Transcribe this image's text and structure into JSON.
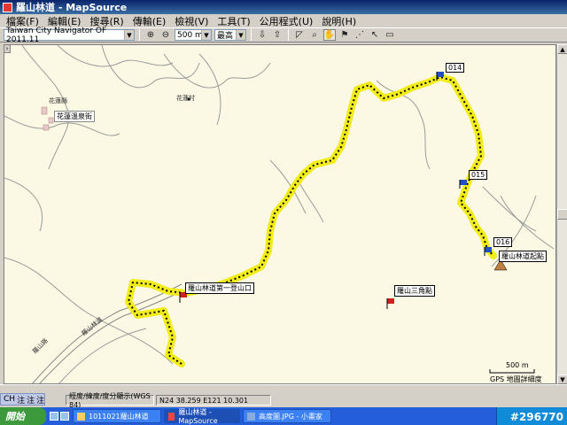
{
  "window": {
    "title": "羅山林道 - MapSource"
  },
  "menu": [
    "檔案(F)",
    "編輯(E)",
    "搜尋(R)",
    "傳輸(E)",
    "檢視(V)",
    "工具(T)",
    "公用程式(U)",
    "說明(H)"
  ],
  "toolbar": {
    "map_product": "Taiwan City Navigator OF 2011.11",
    "zoom": "500 m",
    "detail": "最高"
  },
  "map": {
    "waypoints": [
      {
        "id": "014",
        "label": "014"
      },
      {
        "id": "015",
        "label": "015"
      },
      {
        "id": "016",
        "label": "016"
      }
    ],
    "flags": [
      {
        "label": "羅山林道起點"
      },
      {
        "label": "羅山林道第一登山口"
      },
      {
        "label": "羅山三角點"
      }
    ],
    "places": [
      "花蓮縣",
      "花蓮溫泉街",
      "花蓮村"
    ],
    "roads": [
      "羅山林道",
      "羅山路"
    ],
    "scale_label": "500 m",
    "detail_note": "GPS 地圖詳細度"
  },
  "status": {
    "ime": [
      "CH",
      "注",
      "注",
      "注"
    ],
    "coord_format": "經度/緯度/度分顯示(WGS 84)",
    "position": "N24 38.259 E121 10.301"
  },
  "taskbar": {
    "start": "開始",
    "tasks": [
      "1011021羅山林道",
      "羅山林道 - MapSource",
      "高度圖.JPG - 小畫家"
    ]
  },
  "watermark": "#296770"
}
